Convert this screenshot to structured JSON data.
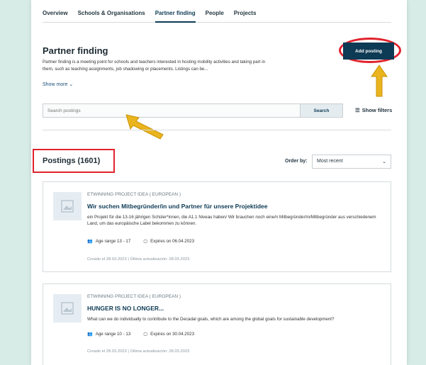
{
  "tabs": [
    "Overview",
    "Schools & Organisations",
    "Partner finding",
    "People",
    "Projects"
  ],
  "active_tab": "Partner finding",
  "page": {
    "title": "Partner finding",
    "description": "Partner finding is a meeting point for schools and teachers interested in hosting mobility activities and taking part in them, such as teaching assignments, job shadowing or placements. Listings can be...",
    "show_more": "Show more",
    "add_button": "Add posting"
  },
  "search": {
    "placeholder": "Search postings",
    "button": "Search",
    "filters": "Show filters"
  },
  "postings_header": "Postings (1601)",
  "order": {
    "label": "Order by:",
    "value": "Most recent"
  },
  "cards": [
    {
      "category": "ETWINNING PROJECT IDEA ( EUROPEAN )",
      "title": "Wir suchen Mitbegründer/in und Partner für unsere Projektidee",
      "text": "ein Projekt für die 13-16 jährigen Schüler*innen, die A1.1 Niveau haben/ Wir brauchen noch eine/n Mitbegründer/in/Mitbegründer aus verschiedenem Land, um das europäische Label bekommen zu können.",
      "age": "Age range 13 - 17",
      "expires": "Expires on 06.04.2023",
      "footer": "Creado el 28.03.2023   |   Última actualización: 28.03.2023"
    },
    {
      "category": "ETWINNING PROJECT IDEA ( EUROPEAN )",
      "title": "HUNGER IS NO LONGER...",
      "text": "What can we do individually to contribute to the Decadal goals, which are among the global goals for sustainable development?",
      "age": "Age range 10 - 13",
      "expires": "Expires on 30.04.2023",
      "footer": "Creado el 28.03.2023   |   Última actualización: 28.03.2023"
    }
  ],
  "colors": {
    "background": "#d7ebe7",
    "primary": "#0d3a55",
    "highlight": "#e0232d",
    "arrow": "#e9b41d"
  }
}
